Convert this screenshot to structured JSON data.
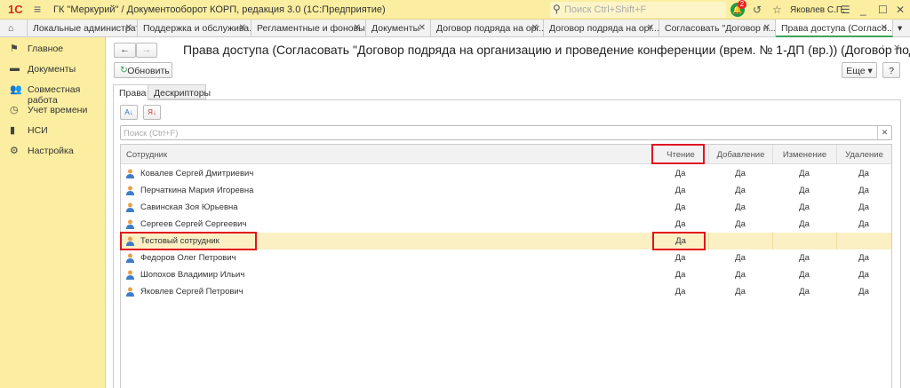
{
  "app": {
    "logo": "1С",
    "title": "ГК \"Меркурий\" / Документооборот КОРП, редакция 3.0  (1С:Предприятие)",
    "search_placeholder": "Поиск Ctrl+Shift+F",
    "notifications": "2",
    "user": "Яковлев С.П."
  },
  "tabs": [
    {
      "label": "Локальные администрат..."
    },
    {
      "label": "Поддержка и обслужива..."
    },
    {
      "label": "Регламентные и фоновы..."
    },
    {
      "label": "Документы"
    },
    {
      "label": "Договор подряда на орг..."
    },
    {
      "label": "Договор подряда на орг..."
    },
    {
      "label": "Согласовать \"Договор п..."
    },
    {
      "label": "Права доступа (Согласо..."
    }
  ],
  "sidebar": [
    {
      "label": "Главное",
      "icon": "flag-icon"
    },
    {
      "label": "Документы",
      "icon": "folder-icon"
    },
    {
      "label": "Совместная работа",
      "icon": "people-icon"
    },
    {
      "label": "Учет времени",
      "icon": "clock-icon"
    },
    {
      "label": "НСИ",
      "icon": "books-icon"
    },
    {
      "label": "Настройка",
      "icon": "gear-icon"
    }
  ],
  "form": {
    "title": "Права доступа (Согласовать \"Договор подряда на организацию и проведение конференции (врем. № 1-ДП (вр.)) (Договор подряд...",
    "refresh": "Обновить",
    "more": "Еще",
    "help": "?",
    "tabs": [
      "Права",
      "Дескрипторы"
    ],
    "search_placeholder": "Поиск (Ctrl+F)"
  },
  "table": {
    "columns": [
      "Сотрудник",
      "Чтение",
      "Добавление",
      "Изменение",
      "Удаление"
    ],
    "rows": [
      {
        "name": "Ковалев Сергей Дмитриевич",
        "r": "Да",
        "a": "Да",
        "e": "Да",
        "d": "Да"
      },
      {
        "name": "Перчаткина Мария Игоревна",
        "r": "Да",
        "a": "Да",
        "e": "Да",
        "d": "Да"
      },
      {
        "name": "Савинская Зоя Юрьевна",
        "r": "Да",
        "a": "Да",
        "e": "Да",
        "d": "Да"
      },
      {
        "name": "Сергеев Сергей Сергеевич",
        "r": "Да",
        "a": "Да",
        "e": "Да",
        "d": "Да"
      },
      {
        "name": "Тестовый сотрудник",
        "r": "Да",
        "a": "",
        "e": "",
        "d": ""
      },
      {
        "name": "Федоров Олег Петрович",
        "r": "Да",
        "a": "Да",
        "e": "Да",
        "d": "Да"
      },
      {
        "name": "Шопохов Владимир Ильич",
        "r": "Да",
        "a": "Да",
        "e": "Да",
        "d": "Да"
      },
      {
        "name": "Яковлев Сергей Петрович",
        "r": "Да",
        "a": "Да",
        "e": "Да",
        "d": "Да"
      }
    ]
  }
}
